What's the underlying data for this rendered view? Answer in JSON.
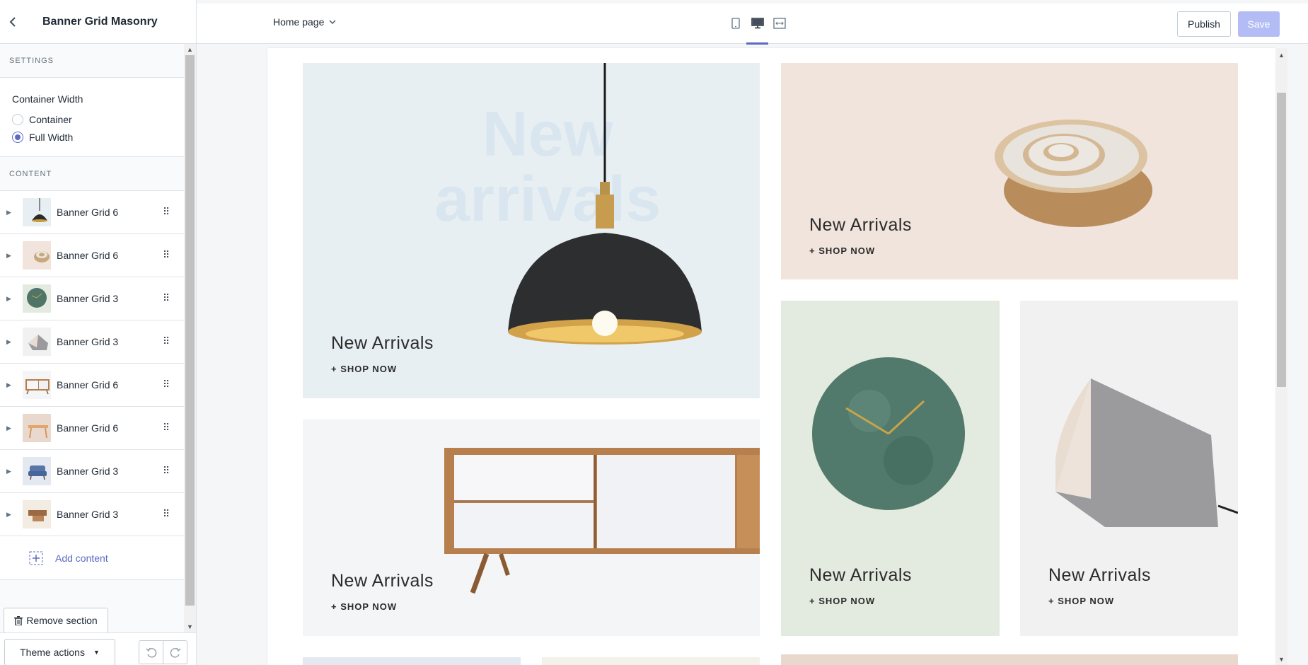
{
  "sidebar": {
    "title": "Banner Grid Masonry",
    "settings_heading": "SETTINGS",
    "container_width_label": "Container Width",
    "options": [
      {
        "label": "Container",
        "checked": false
      },
      {
        "label": "Full Width",
        "checked": true
      }
    ],
    "content_heading": "CONTENT",
    "items": [
      {
        "label": "Banner Grid 6",
        "thumb": "lamp"
      },
      {
        "label": "Banner Grid 6",
        "thumb": "bowl"
      },
      {
        "label": "Banner Grid 3",
        "thumb": "clock"
      },
      {
        "label": "Banner Grid 3",
        "thumb": "speaker"
      },
      {
        "label": "Banner Grid 6",
        "thumb": "sideboard"
      },
      {
        "label": "Banner Grid 6",
        "thumb": "table"
      },
      {
        "label": "Banner Grid 3",
        "thumb": "chair"
      },
      {
        "label": "Banner Grid 3",
        "thumb": "wood"
      }
    ],
    "add_content_label": "Add content",
    "remove_section_label": "Remove section",
    "theme_actions_label": "Theme actions"
  },
  "topbar": {
    "page_select": "Home page",
    "publish_label": "Publish",
    "save_label": "Save"
  },
  "preview": {
    "watermark_line1": "New",
    "watermark_line2": "arrivals",
    "tiles": [
      {
        "title": "New Arrivals",
        "link": "+ SHOP NOW",
        "bg": "#e8eff3"
      },
      {
        "title": "New Arrivals",
        "link": "+ SHOP NOW",
        "bg": "#f0e4dc"
      },
      {
        "title": "New Arrivals",
        "link": "+ SHOP NOW",
        "bg": "#f4f5f6"
      },
      {
        "title": "New Arrivals",
        "link": "+ SHOP NOW",
        "bg": "#e3ebe0"
      },
      {
        "title": "New Arrivals",
        "link": "+ SHOP NOW",
        "bg": "#f1f1f2"
      }
    ]
  },
  "colors": {
    "accent": "#5c6ac4",
    "save_disabled": "#b3bcf5"
  }
}
